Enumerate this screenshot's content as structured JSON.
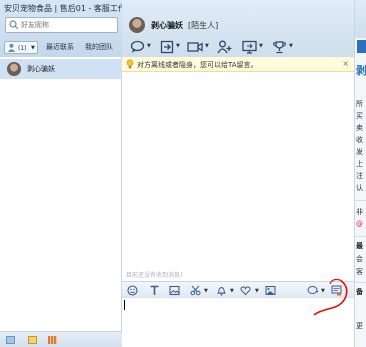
{
  "window": {
    "title": "安贝宠物食品 | 售后01 - 客服工作台"
  },
  "search": {
    "placeholder": "好友昵称"
  },
  "left_tabs": {
    "status_count": "(1)",
    "recent": "最近联系",
    "team": "我的团队"
  },
  "contacts": [
    {
      "name": "剥心骗妖"
    }
  ],
  "chat": {
    "contact_name": "剥心骗妖",
    "contact_tag": "[陌生人]",
    "notice": "对方离线或者隐身，您可以给TA留言。",
    "input_hint": "目前还没有收到消息！"
  },
  "right_panel": {
    "big_char": "剥",
    "lines": [
      "所",
      "买",
      "卖",
      "收",
      "发",
      "上",
      "注",
      "认"
    ],
    "mid_lines": [
      "非",
      "@"
    ],
    "labels": [
      "最",
      "会",
      "客",
      "备"
    ],
    "last": "更"
  },
  "colors": {
    "accent": "#2c6fc4",
    "highlight_row": "#cfe1f2",
    "notice_bg": "#fffbdc",
    "annotation": "#e01010"
  },
  "icons": {
    "toolbar": [
      "chat-bubble-icon",
      "transfer-icon",
      "video-icon",
      "add-user-icon",
      "screen-share-icon",
      "trophy-icon"
    ],
    "input_bar": [
      "emoji-icon",
      "font-icon",
      "image-icon",
      "scissors-icon",
      "bell-icon",
      "heart-icon",
      "picture-icon",
      "message-history-icon",
      "quick-reply-icon"
    ]
  }
}
